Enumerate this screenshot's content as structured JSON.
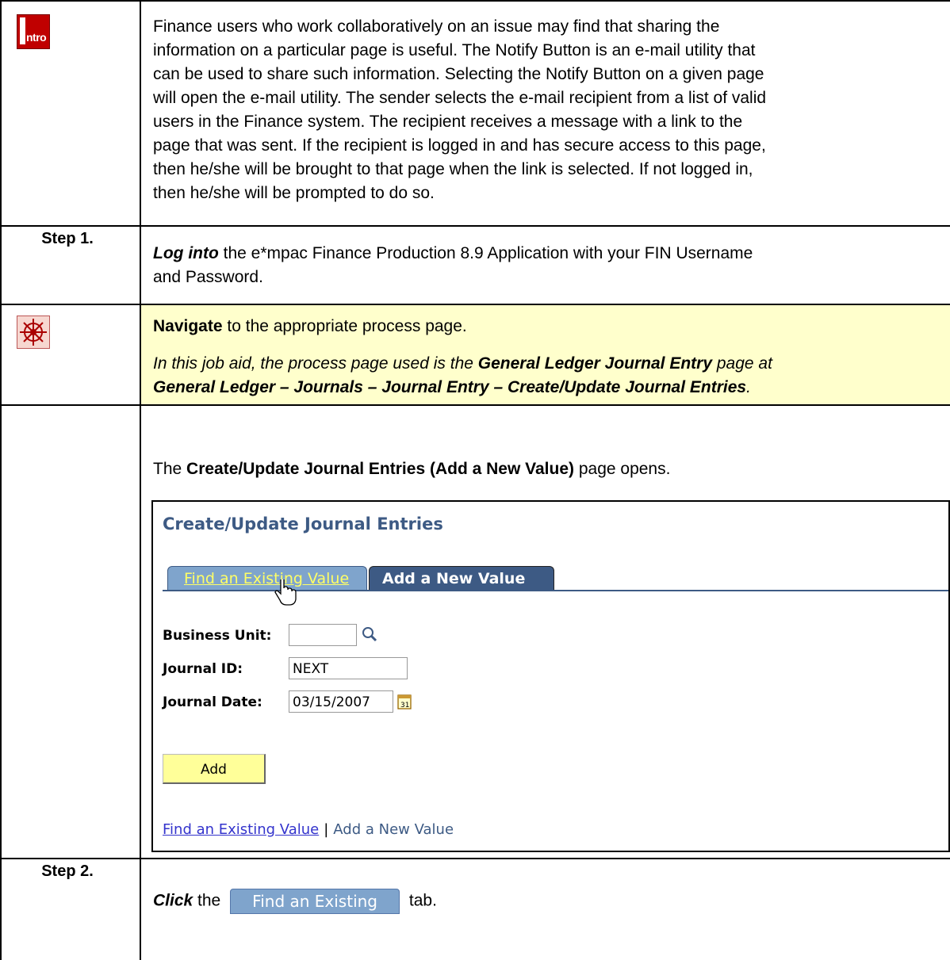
{
  "intro": {
    "icon_label": "ntro",
    "lines": [
      "Finance users who work collaboratively on an issue may find that sharing the",
      "information on a particular page is useful.  The Notify Button is an e-mail utility that",
      "can be used to share such information. Selecting the Notify Button on a given page",
      "will open the e-mail utility.  The sender selects the e-mail recipient from a list of valid",
      "users in the Finance system.  The recipient receives a message with a link to the",
      "page that was sent.  If the recipient is logged in and has secure access to this page,",
      "then he/she will be brought to that page when the link is selected. If not logged in,",
      "then he/she will be prompted to do so."
    ]
  },
  "step1": {
    "label": "Step 1.",
    "action": "Log into",
    "text_a": " the e*mpac Finance Production 8.9 Application with your FIN Username",
    "text_b": "and Password."
  },
  "navigate": {
    "action": "Navigate",
    "text": " to the appropriate process page.",
    "italic_a": "In this job aid, the process page used is the ",
    "italic_bold_a": "General Ledger Journal Entry",
    "italic_b": " page at",
    "italic_bold_b": "General Ledger – Journals – Journal Entry – Create/Update Journal Entries",
    "italic_end": "."
  },
  "opens": {
    "pre": "The ",
    "bold": "Create/Update Journal Entries (Add a New Value)",
    "post": " page opens."
  },
  "screenshot": {
    "title": "Create/Update Journal Entries",
    "tab_find": "Find an Existing Value",
    "tab_add": "Add a New Value",
    "business_unit_label": "Business Unit:",
    "business_unit_value": "",
    "journal_id_label": "Journal ID:",
    "journal_id_value": "NEXT",
    "journal_date_label": "Journal Date:",
    "journal_date_value": "03/15/2007",
    "add_button": "Add",
    "link_find": "Find an Existing Value",
    "link_sep": "|",
    "link_add": "Add a New Value"
  },
  "step2": {
    "label": "Step 2.",
    "action": "Click",
    "pre": " the ",
    "tab_label": "Find an Existing Value",
    "post": " tab."
  }
}
